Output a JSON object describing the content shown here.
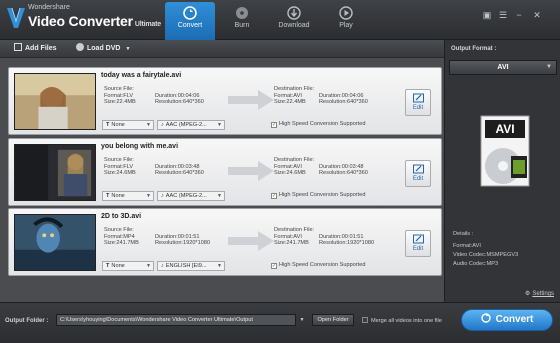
{
  "app": {
    "brand_small": "Wondershare",
    "brand_main": "Video Converter",
    "brand_sub": "Ultimate"
  },
  "tabs": [
    {
      "label": "Convert",
      "icon": "convert-icon",
      "active": true
    },
    {
      "label": "Burn",
      "icon": "burn-disc-icon",
      "active": false
    },
    {
      "label": "Download",
      "icon": "download-icon",
      "active": false
    },
    {
      "label": "Play",
      "icon": "play-icon",
      "active": false
    }
  ],
  "toolbar": {
    "add_files": "Add Files",
    "load_dvd": "Load DVD"
  },
  "items": [
    {
      "name": "today was a fairytale.avi",
      "source": {
        "label": "Source File:",
        "format": "Format:FLV",
        "size": "Size:22.4MB",
        "duration": "Duration:00:04:06",
        "resolution": "Resolution:640*360"
      },
      "destination": {
        "label": "Destination File:",
        "format": "Format:AVI",
        "size": "Size:22.4MB",
        "duration": "Duration:00:04:06",
        "resolution": "Resolution:640*360"
      },
      "subtitle": "None",
      "audio": "AAC (MPEG-2...",
      "high_speed": "High Speed Conversion Supported",
      "edit": "Edit"
    },
    {
      "name": "you belong with me.avi",
      "source": {
        "label": "Source File:",
        "format": "Format:FLV",
        "size": "Size:24.6MB",
        "duration": "Duration:00:03:48",
        "resolution": "Resolution:640*360"
      },
      "destination": {
        "label": "Destination File:",
        "format": "Format:AVI",
        "size": "Size:24.6MB",
        "duration": "Duration:00:03:48",
        "resolution": "Resolution:640*360"
      },
      "subtitle": "None",
      "audio": "AAC (MPEG-2...",
      "high_speed": "High Speed Conversion Supported",
      "edit": "Edit"
    },
    {
      "name": "2D to 3D.avi",
      "source": {
        "label": "Source File:",
        "format": "Format:MP4",
        "size": "Size:241.7MB",
        "duration": "Duration:00:01:51",
        "resolution": "Resolution:1920*1080"
      },
      "destination": {
        "label": "Destination File:",
        "format": "Format:AVI",
        "size": "Size:241.7MB",
        "duration": "Duration:00:01:51",
        "resolution": "Resolution:1920*1080"
      },
      "subtitle": "None",
      "audio": "ENGLISH [EI9...",
      "high_speed": "High Speed Conversion Supported",
      "edit": "Edit"
    }
  ],
  "output_panel": {
    "label": "Output Format :",
    "format": "AVI",
    "icon_text": "AVI",
    "details_label": "Details :",
    "details": [
      "Format:AVI",
      "Video Codec:MSMPEGV3",
      "Audio Codec:MP3"
    ],
    "settings": "Settings"
  },
  "bottom": {
    "output_folder_label": "Output Folder :",
    "output_folder_path": "C:\\Users\\yhouying\\Documents\\Wondershare Video Converter Ultimate\\Output",
    "open_folder": "Open Folder",
    "merge_label": "Merge all videos into one file",
    "convert": "Convert"
  },
  "colors": {
    "accent": "#2a82d0",
    "convert_button": "#3a94e0",
    "background": "#3a3c3f"
  }
}
